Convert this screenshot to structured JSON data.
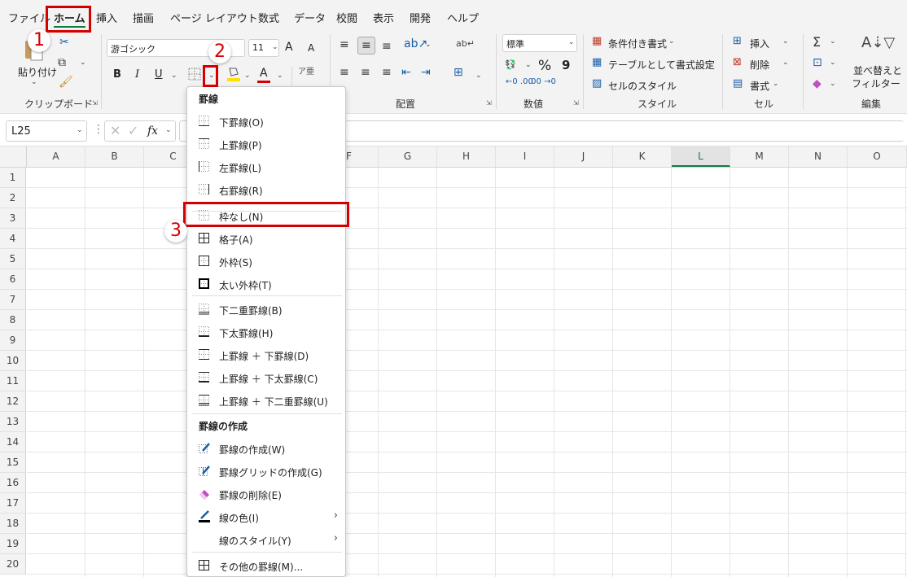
{
  "tabs": [
    {
      "label": "ファイル"
    },
    {
      "label": "ホーム"
    },
    {
      "label": "挿入"
    },
    {
      "label": "描画"
    },
    {
      "label": "ページ レイアウト"
    },
    {
      "label": "数式"
    },
    {
      "label": "データ"
    },
    {
      "label": "校閲"
    },
    {
      "label": "表示"
    },
    {
      "label": "開発"
    },
    {
      "label": "ヘルプ"
    }
  ],
  "ribbon": {
    "clipboard": {
      "paste_label": "貼り付け",
      "group_name": "クリップボード"
    },
    "font": {
      "font_name": "游ゴシック",
      "font_size": "11",
      "bold": "B",
      "italic": "I",
      "underline": "U",
      "grow": "A",
      "shrink": "A",
      "color_letter": "A",
      "font_color": "#d40000",
      "highlight_color": "#ffe000"
    },
    "alignment": {
      "group_name": "配置"
    },
    "number": {
      "format": "標準",
      "percent": "%",
      "comma": "9",
      "group_name": "数値"
    },
    "styles": {
      "conditional": "条件付き書式",
      "as_table": "テーブルとして書式設定",
      "cell_styles": "セルのスタイル",
      "group_name": "スタイル"
    },
    "cells": {
      "insert": "挿入",
      "delete": "削除",
      "format": "書式",
      "group_name": "セル"
    },
    "editing": {
      "sort_line1": "並べ替えと",
      "sort_line2": "フィルター",
      "group_name": "編集"
    }
  },
  "formula_bar": {
    "name_box": "L25",
    "fx": "fx"
  },
  "grid": {
    "columns": [
      "A",
      "B",
      "C",
      "D",
      "E",
      "F",
      "G",
      "H",
      "I",
      "J",
      "K",
      "L",
      "M",
      "N",
      "O"
    ],
    "selected_column": "L",
    "rows": [
      "1",
      "2",
      "3",
      "4",
      "5",
      "6",
      "7",
      "8",
      "9",
      "10",
      "11",
      "12",
      "13",
      "14",
      "15",
      "16",
      "17",
      "18",
      "19",
      "20"
    ]
  },
  "menu": {
    "header_borders": "罫線",
    "header_draw": "罫線の作成",
    "items": [
      {
        "label": "下罫線(O)",
        "icon": "bottom-border-icon"
      },
      {
        "label": "上罫線(P)",
        "icon": "top-border-icon"
      },
      {
        "label": "左罫線(L)",
        "icon": "left-border-icon"
      },
      {
        "label": "右罫線(R)",
        "icon": "right-border-icon"
      },
      {
        "label": "枠なし(N)",
        "icon": "no-border-icon"
      },
      {
        "label": "格子(A)",
        "icon": "all-borders-icon"
      },
      {
        "label": "外枠(S)",
        "icon": "outside-borders-icon"
      },
      {
        "label": "太い外枠(T)",
        "icon": "thick-outside-borders-icon"
      },
      {
        "label": "下二重罫線(B)",
        "icon": "double-bottom-border-icon"
      },
      {
        "label": "下太罫線(H)",
        "icon": "thick-bottom-border-icon"
      },
      {
        "label": "上罫線 ＋ 下罫線(D)",
        "icon": "top-bottom-border-icon"
      },
      {
        "label": "上罫線 ＋ 下太罫線(C)",
        "icon": "top-thick-bottom-border-icon"
      },
      {
        "label": "上罫線 ＋ 下二重罫線(U)",
        "icon": "top-double-bottom-border-icon"
      },
      {
        "label": "罫線の作成(W)",
        "icon": "draw-border-icon"
      },
      {
        "label": "罫線グリッドの作成(G)",
        "icon": "draw-border-grid-icon"
      },
      {
        "label": "罫線の削除(E)",
        "icon": "erase-border-icon"
      },
      {
        "label": "線の色(I)",
        "icon": "line-color-icon"
      },
      {
        "label": "線のスタイル(Y)",
        "icon": "line-style-icon"
      },
      {
        "label": "その他の罫線(M)...",
        "icon": "more-borders-icon"
      }
    ]
  },
  "annotations": {
    "step1": "1",
    "step2": "2",
    "step3": "3",
    "color": "#d40000"
  }
}
